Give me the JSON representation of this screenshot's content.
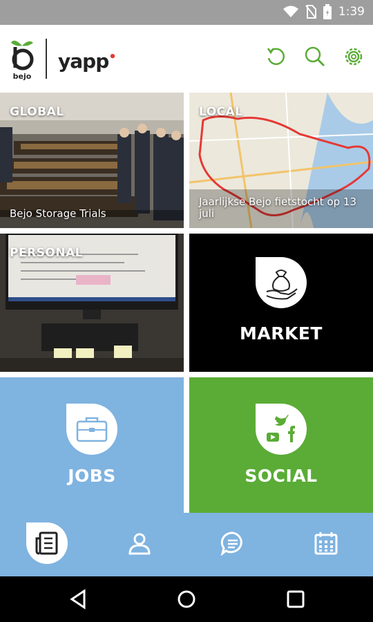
{
  "status_bar": {
    "time": "1:39",
    "icons": [
      "wifi-icon",
      "sim-off-icon",
      "battery-icon"
    ]
  },
  "header": {
    "logo_left": "bejo",
    "logo_right": "yapp",
    "actions": [
      "refresh-icon",
      "search-icon",
      "settings-icon"
    ],
    "accent": "#5aac36"
  },
  "tiles": {
    "global": {
      "tag": "GLOBAL",
      "caption": "Bejo Storage Trials"
    },
    "local": {
      "tag": "LOCAL",
      "caption": "Jaarlijkse Bejo fietstocht op 13 juli"
    },
    "personal": {
      "tag": "PERSONAL"
    },
    "market": {
      "label": "MARKET",
      "icon": "money-bag-hand-icon",
      "color": "#000000"
    },
    "jobs": {
      "label": "JOBS",
      "icon": "briefcase-icon",
      "color": "#7fb3e0"
    },
    "social": {
      "label": "SOCIAL",
      "icon": "social-media-icon",
      "color": "#5aac36"
    }
  },
  "bottom_nav": {
    "items": [
      "news-icon",
      "profile-icon",
      "chat-icon",
      "calendar-icon"
    ],
    "active": "news-icon",
    "color": "#7fb3e0"
  },
  "system_nav": [
    "back-icon",
    "home-icon",
    "recents-icon"
  ]
}
